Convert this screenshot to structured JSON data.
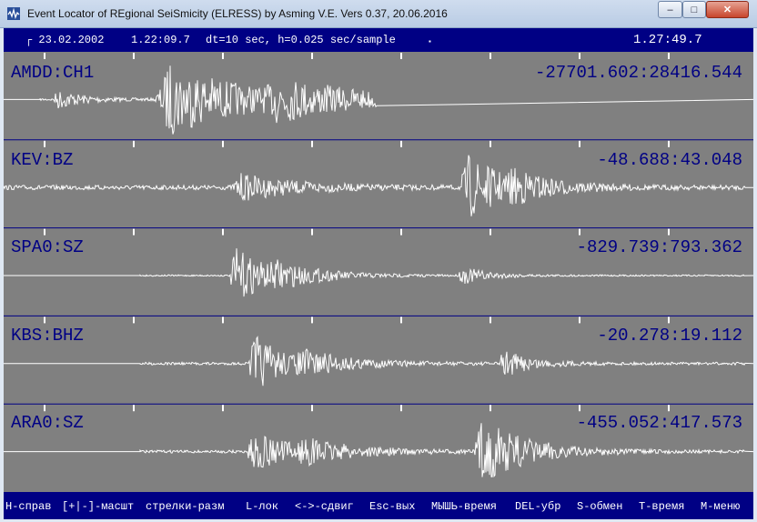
{
  "window": {
    "title": "Event Locator of REgional SeiSmicity (ELRESS) by Asming V.E. Vers 0.37, 20.06.2016",
    "minimize_glyph": "–",
    "maximize_glyph": "□",
    "close_glyph": "✕"
  },
  "info_bar": {
    "date": "┌ 23.02.2002",
    "start_time": "1.22:09.7",
    "params": "dt=10 sec, h=0.025 sec/sample",
    "cursor_mark": "▪",
    "current_time": "1.27:49.7"
  },
  "channels": [
    {
      "name": "AMDD:CH1",
      "range": "-27701.602:28416.544"
    },
    {
      "name": "KEV:BZ",
      "range": "-48.688:43.048"
    },
    {
      "name": "SPA0:SZ",
      "range": "-829.739:793.362"
    },
    {
      "name": "KBS:BHZ",
      "range": "-20.278:19.112"
    },
    {
      "name": "ARA0:SZ",
      "range": "-455.052:417.573"
    }
  ],
  "status_bar": {
    "items": [
      "H-справ",
      "[+|-]-масшт",
      "стрелки-разм",
      "L-лок",
      "<->-сдвиг",
      "Esc-вых",
      "МЫШЬ-время",
      "DEL-убр",
      "S-обмен",
      "T-время",
      "M-меню"
    ]
  },
  "colors": {
    "frame": "#000084",
    "panel": "#808080",
    "trace": "#ffffff",
    "label": "#000084"
  }
}
